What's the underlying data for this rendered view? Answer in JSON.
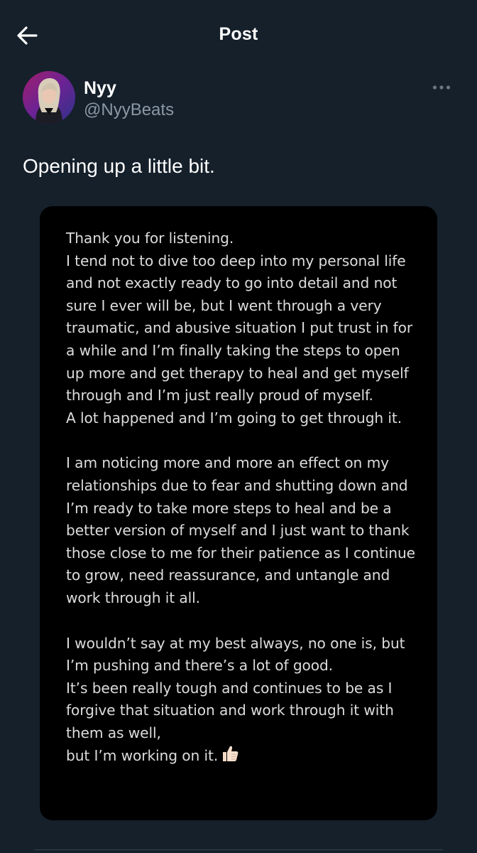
{
  "header": {
    "title": "Post",
    "back_icon": "arrow-left-icon"
  },
  "author": {
    "name": "Nyy",
    "handle": "@NyyBeats",
    "more_icon": "more-horizontal-icon"
  },
  "post": {
    "text": "Opening up a little bit."
  },
  "media_note": {
    "paragraph1": [
      "Thank you for listening.",
      "I tend not to dive too deep into my personal life",
      "and not exactly ready to go into detail and not",
      "sure I ever will be, but I went through a very",
      "traumatic, and abusive situation I put trust in for",
      "a while and I’m finally taking the steps to open",
      "up more and get therapy to heal and get myself",
      "through and I’m just really proud of myself.",
      "A lot happened and I’m going to get through it."
    ],
    "paragraph2": [
      "I am noticing more and more an effect on my",
      "relationships due to fear and shutting down and",
      "I’m ready to take more steps to heal and be a",
      "better version of myself and I just want to thank",
      "those close to me for their patience as I continue",
      "to grow, need reassurance, and untangle and",
      "work through it all."
    ],
    "paragraph3": [
      "I wouldn’t say at my best always, no one is, but",
      "I’m pushing and there’s a lot of good.",
      "It’s been really tough and continues to be as I",
      "forgive that situation and work through it with",
      "them as well,",
      "but I’m working on it."
    ],
    "emoji_icon": "thumbs-up-icon"
  },
  "colors": {
    "background": "#15202b",
    "secondary_text": "#8b98a5",
    "card": "#000000"
  }
}
